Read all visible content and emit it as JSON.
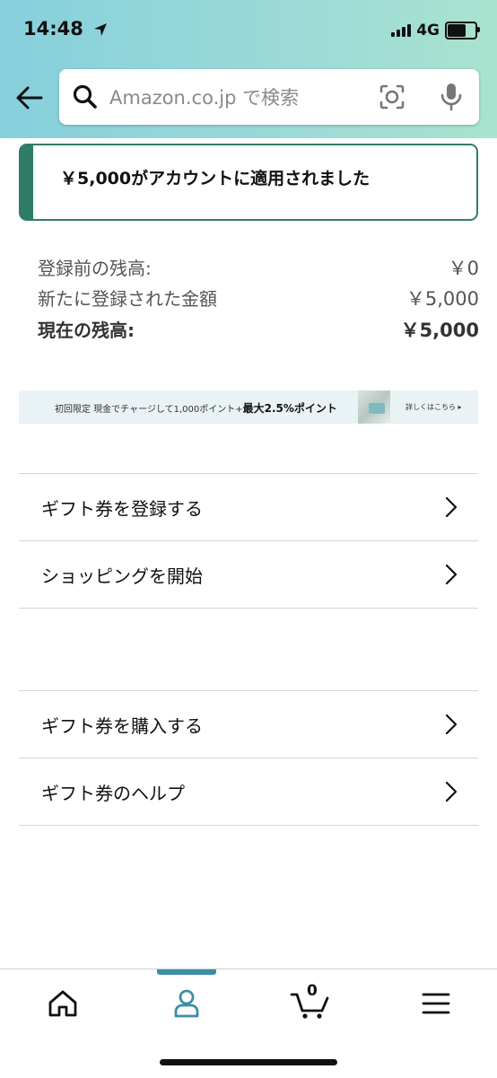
{
  "status_bar": {
    "time": "14:48",
    "network": "4G"
  },
  "search": {
    "placeholder": "Amazon.co.jp で検索"
  },
  "alert": {
    "message": "￥5,000がアカウントに適用されました"
  },
  "balance": {
    "rows": [
      {
        "label": "登録前の残高:",
        "value": "￥0"
      },
      {
        "label": "新たに登録された金額",
        "value": "￥5,000"
      },
      {
        "label": "現在の残高:",
        "value": "￥5,000"
      }
    ]
  },
  "banner": {
    "text_prefix": "初回限定  現金でチャージして1,000ポイント+",
    "text_emphasis": "最大2.5%ポイント",
    "link": "詳しくはこちら ▸"
  },
  "menu_group_1": [
    {
      "label": "ギフト券を登録する"
    },
    {
      "label": "ショッピングを開始"
    }
  ],
  "menu_group_2": [
    {
      "label": "ギフト券を購入する"
    },
    {
      "label": "ギフト券のヘルプ"
    }
  ],
  "tabbar": {
    "cart_count": "0",
    "icons": [
      "home-icon",
      "account-icon",
      "cart-icon",
      "menu-icon"
    ],
    "accent": "#3a8fa3"
  },
  "colors": {
    "alert_accent": "#2f7d66",
    "header_gradient_start": "#86d0dc",
    "header_gradient_end": "#a9e3cf"
  }
}
